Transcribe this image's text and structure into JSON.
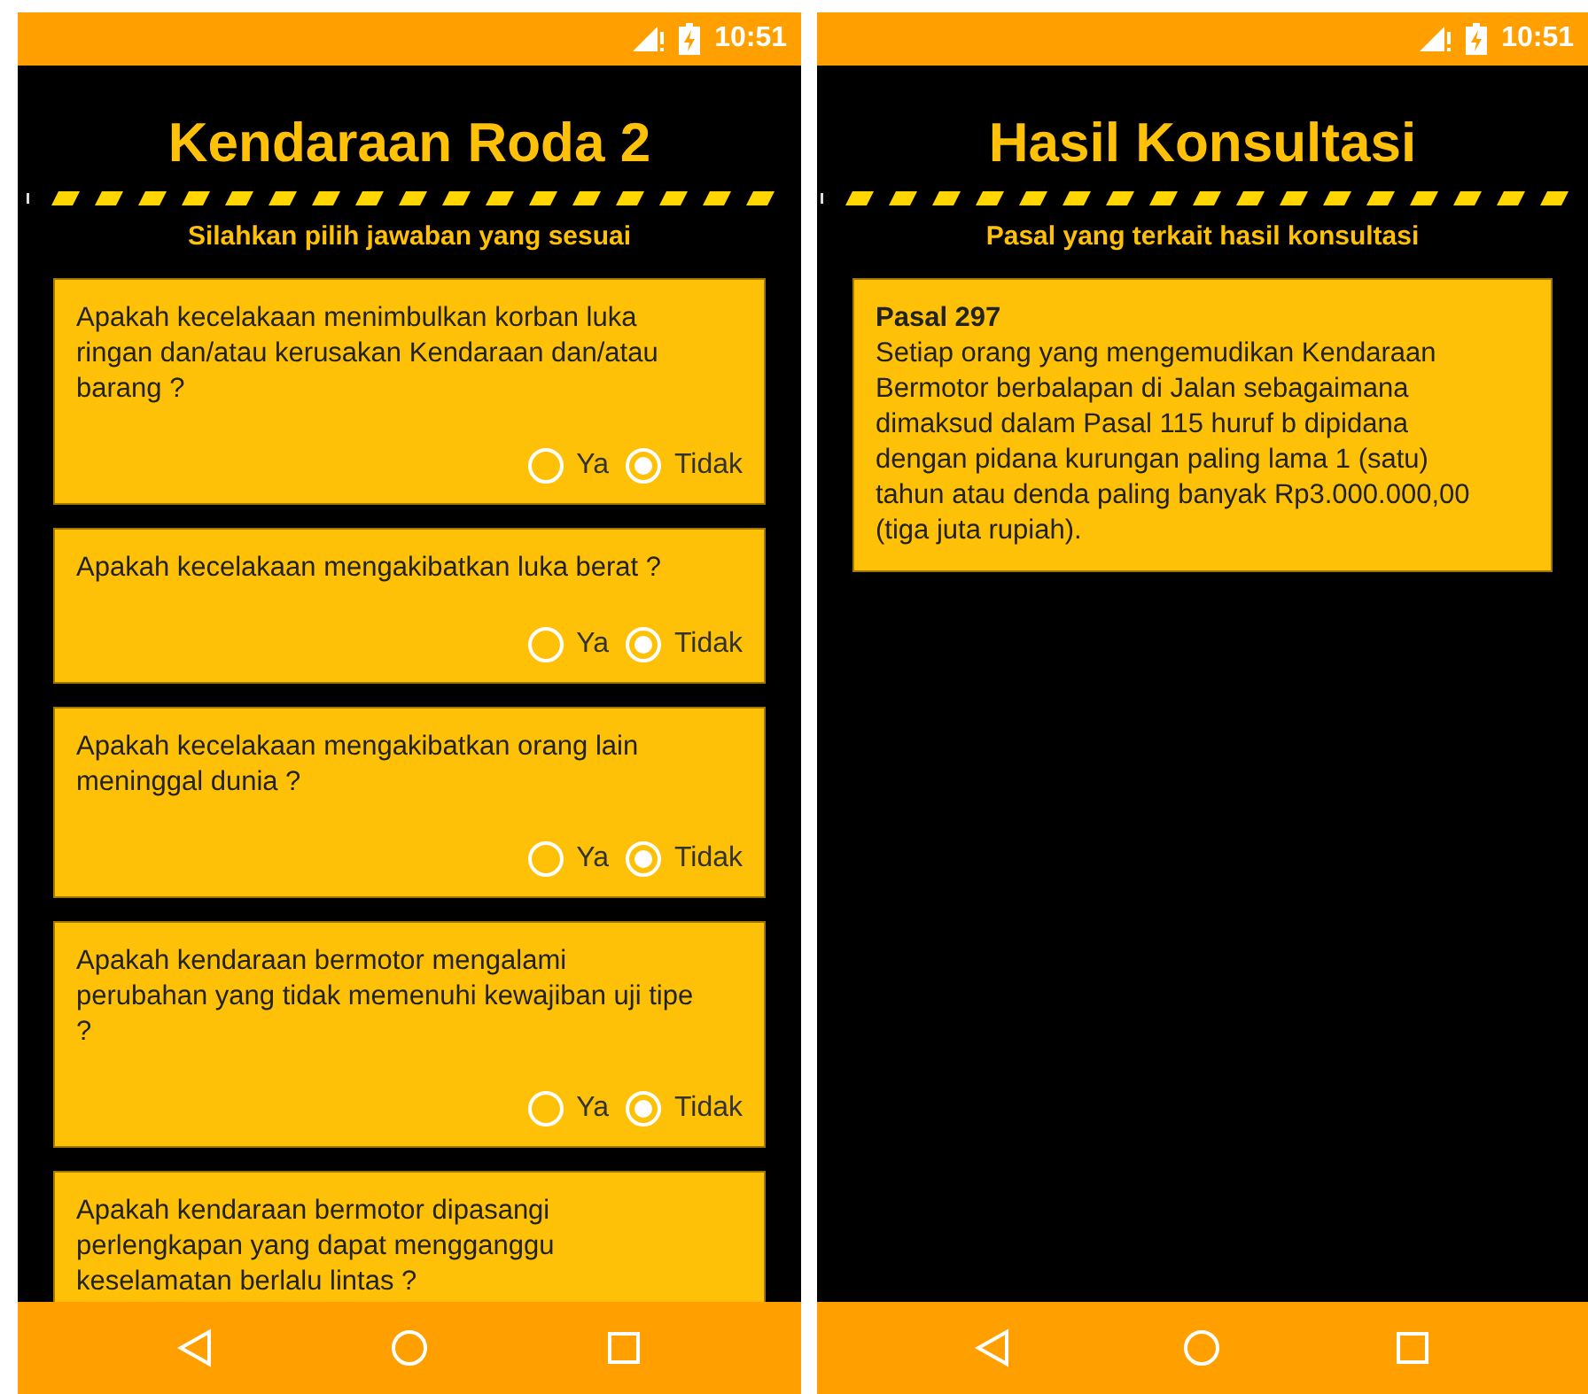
{
  "screens": [
    {
      "kind": "quiz",
      "status_time": "10:51",
      "title": "Kendaraan Roda 2",
      "subtitle": "Silahkan pilih jawaban yang sesuai",
      "questions": [
        {
          "text": "Apakah kecelakaan menimbulkan korban luka ringan dan/atau kerusakan Kendaraan dan/atau barang ?",
          "options": [
            {
              "label": "Ya",
              "selected": false
            },
            {
              "label": "Tidak",
              "selected": true
            }
          ]
        },
        {
          "text": "Apakah kecelakaan mengakibatkan luka berat ?",
          "options": [
            {
              "label": "Ya",
              "selected": false
            },
            {
              "label": "Tidak",
              "selected": true
            }
          ]
        },
        {
          "text": "Apakah kecelakaan mengakibatkan orang lain meninggal dunia ?",
          "options": [
            {
              "label": "Ya",
              "selected": false
            },
            {
              "label": "Tidak",
              "selected": true
            }
          ]
        },
        {
          "text": "Apakah kendaraan bermotor mengalami perubahan yang tidak memenuhi kewajiban uji tipe ?",
          "options": [
            {
              "label": "Ya",
              "selected": false
            },
            {
              "label": "Tidak",
              "selected": true
            }
          ]
        },
        {
          "text": "Apakah kendaraan bermotor dipasangi perlengkapan yang dapat mengganggu keselamatan berlalu lintas ?"
        }
      ]
    },
    {
      "kind": "result",
      "status_time": "10:51",
      "title": "Hasil Konsultasi",
      "subtitle": "Pasal yang terkait hasil konsultasi",
      "results": [
        {
          "heading": "Pasal 297",
          "body": "Setiap orang yang mengemudikan Kendaraan Bermotor berbalapan di Jalan sebagaimana dimaksud dalam Pasal 115 huruf b dipidana dengan pidana kurungan paling lama 1 (satu) tahun atau denda paling banyak Rp3.000.000,00 (tiga juta rupiah)."
        }
      ]
    }
  ]
}
